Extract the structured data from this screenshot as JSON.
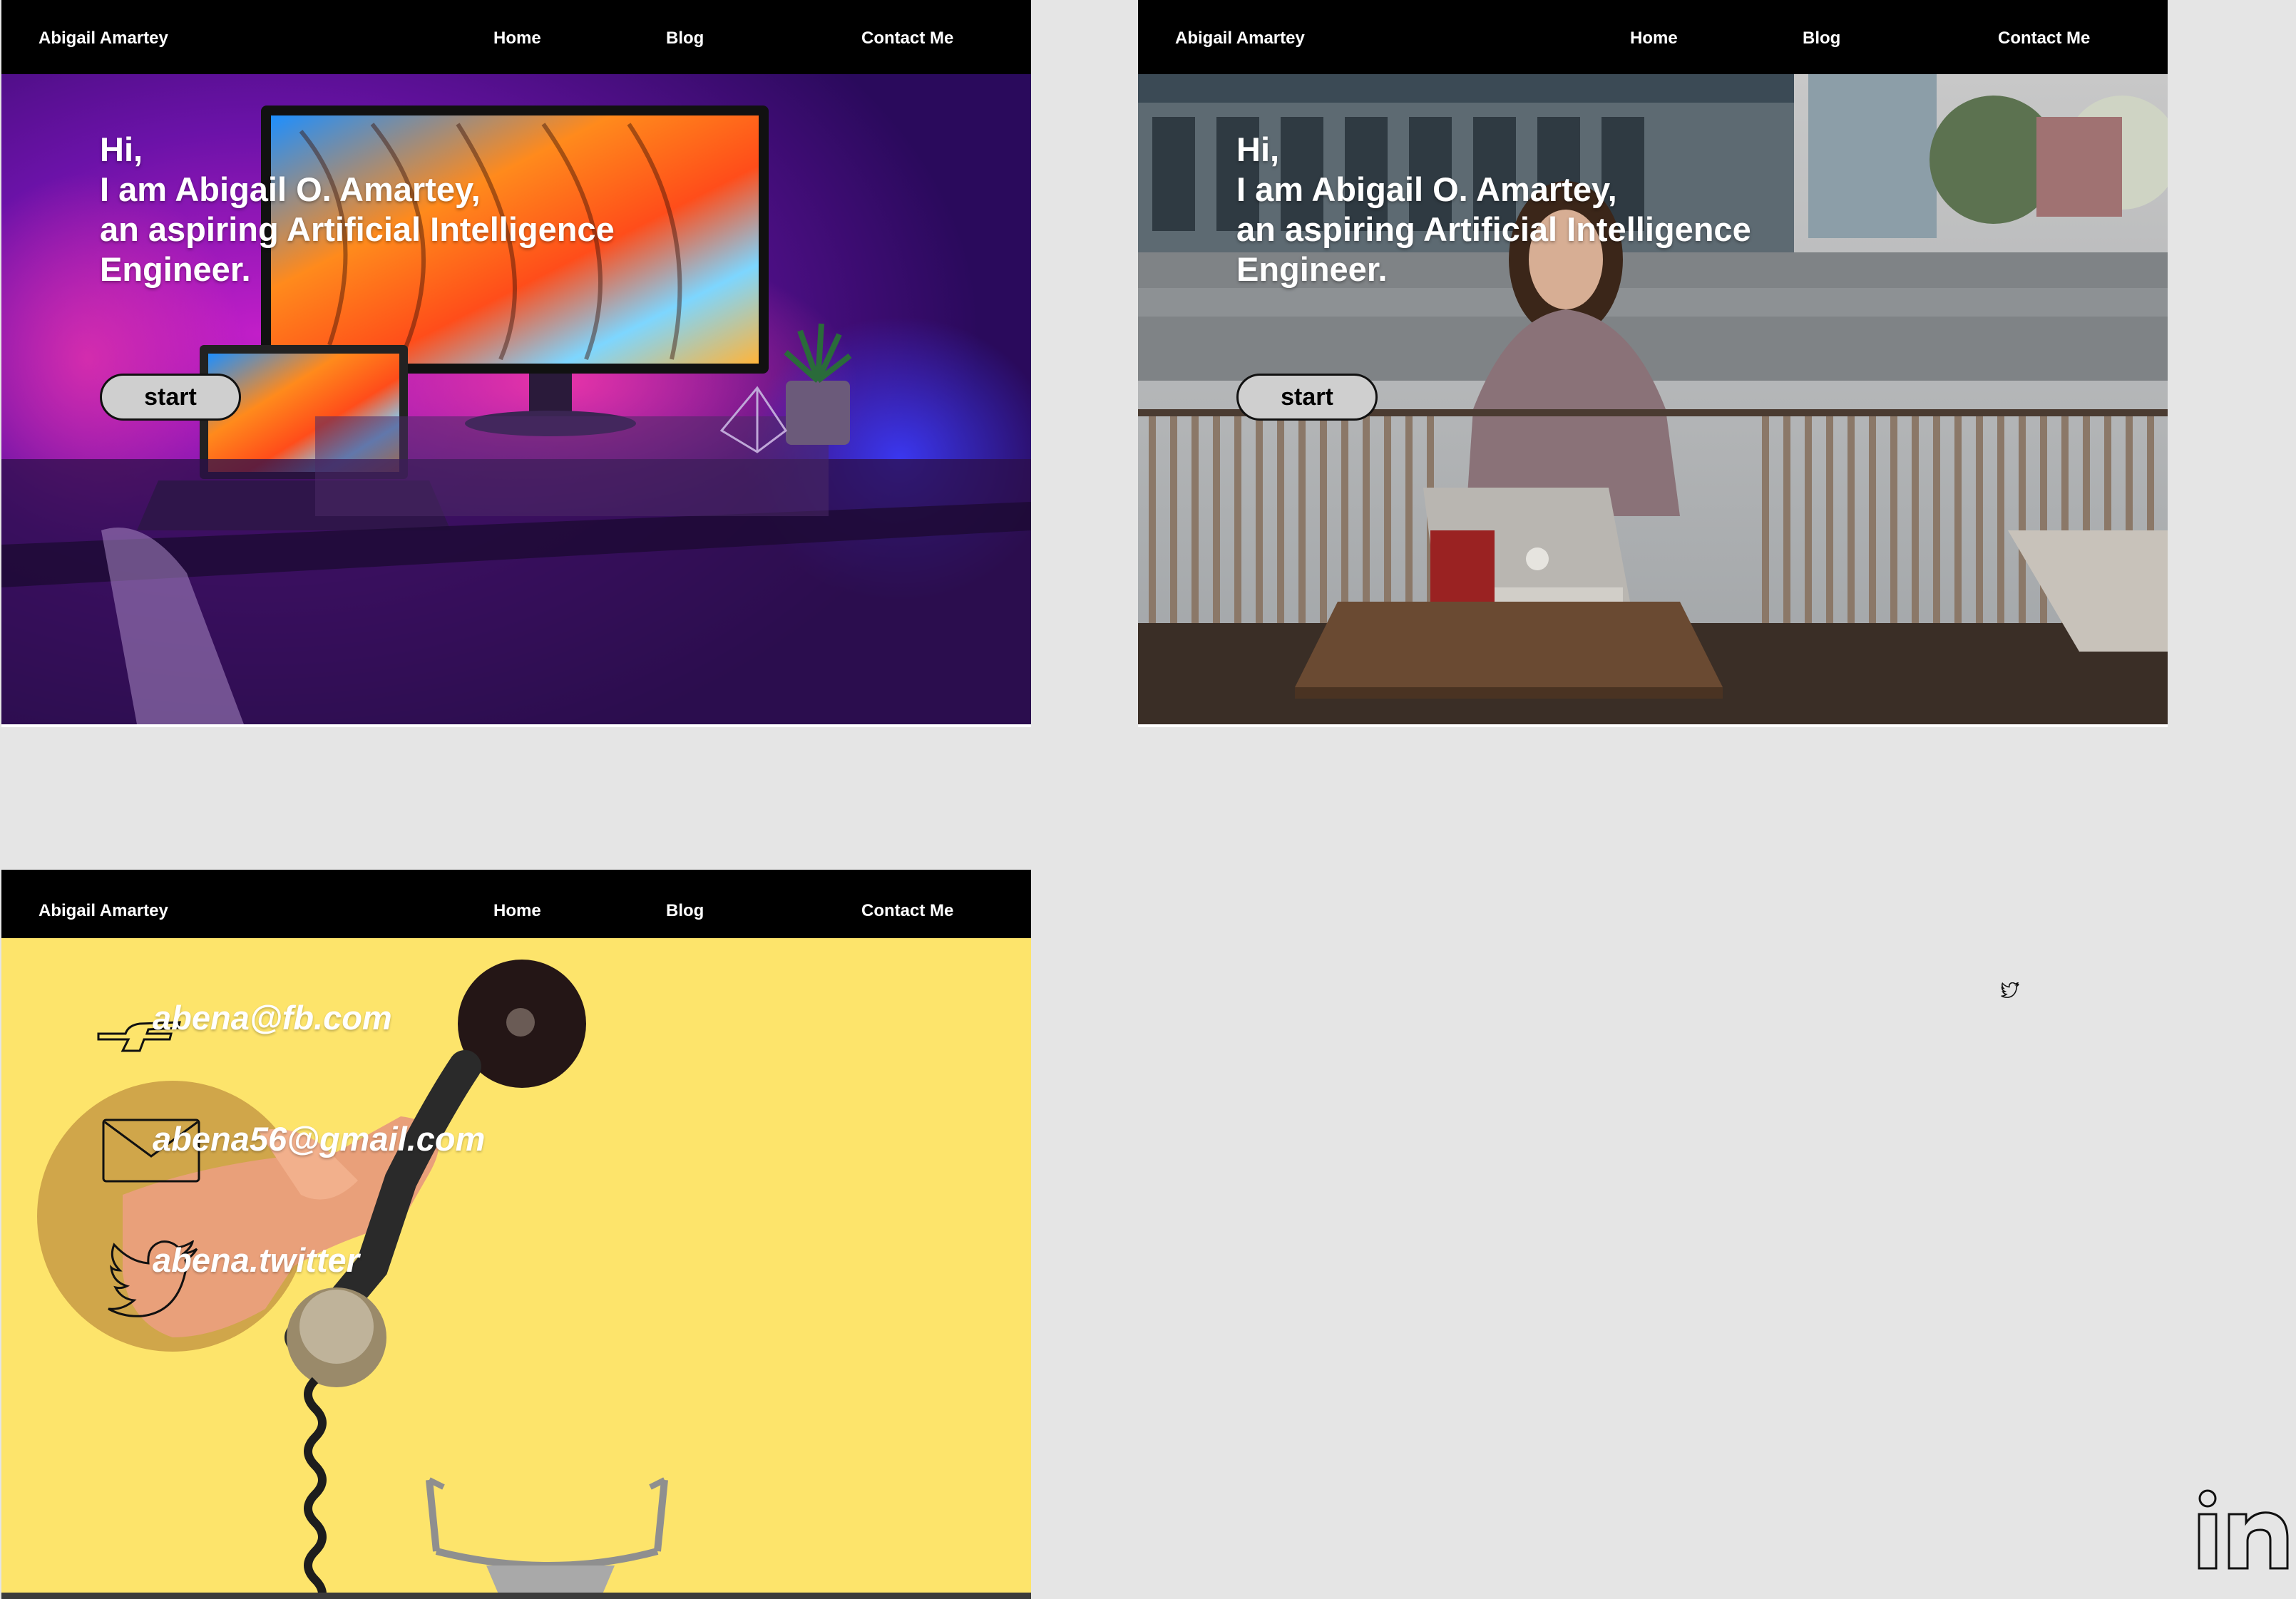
{
  "nav": {
    "brand": "Abigail Amartey",
    "home": "Home",
    "blog": "Blog",
    "contact": "Contact Me"
  },
  "hero": {
    "line1": "Hi,",
    "line2": "I am Abigail O. Amartey,",
    "line3": "an aspiring Artificial Intelligence",
    "line4": "Engineer.",
    "start_label": "start"
  },
  "contact": {
    "facebook": "abena@fb.com",
    "email": "abena56@gmail.com",
    "twitter": "abena.twitter"
  },
  "icons": {
    "facebook": "facebook-pointing-hand-icon",
    "email": "envelope-icon",
    "twitter": "twitter-bird-icon",
    "linkedin": "linkedin-icon"
  },
  "colors": {
    "navbar": "#000000",
    "canvas": "#e5e5e5",
    "contact_bg": "#fde46b",
    "hero_text": "#ffffff",
    "button_bg": "#cfcfcf"
  }
}
